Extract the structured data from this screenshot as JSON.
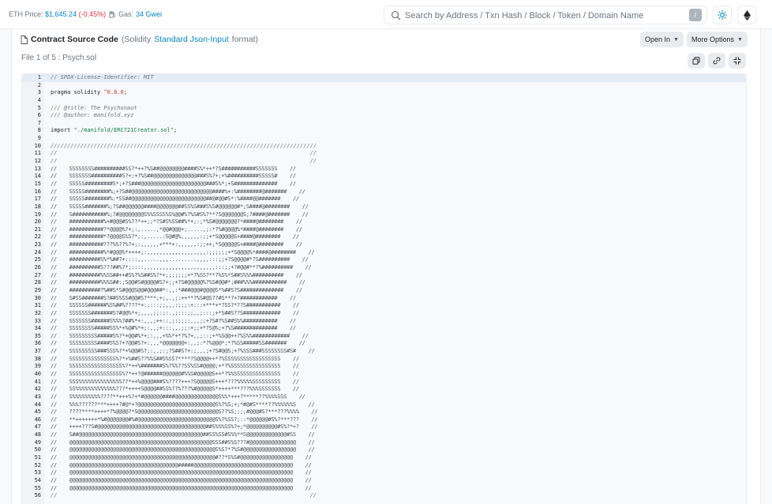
{
  "header": {
    "eth_price_label": "ETH Price:",
    "eth_price_value": "$1,645.24",
    "eth_price_change": "(-0.45%)",
    "gas_label": "Gas:",
    "gas_value": "34 Gwei",
    "search_placeholder": "Search by Address / Txn Hash / Block / Token / Domain Name",
    "search_shortcut": "/"
  },
  "contract": {
    "title": "Contract Source Code",
    "lang_prefix": "(Solidity",
    "lang_link": "Standard Json-Input",
    "lang_suffix": "format)",
    "open_in": "Open In",
    "more_options": "More Options",
    "file_label": "File 1 of 5 : Psych.sol"
  },
  "code_lines": [
    {
      "n": "1",
      "t": "// SPDX-License-Identifier: MIT",
      "k": "cmt"
    },
    {
      "n": "2",
      "t": "",
      "k": ""
    },
    {
      "n": "3",
      "t": "pragma solidity ^0.8.0;",
      "k": "pragma"
    },
    {
      "n": "4",
      "t": "",
      "k": ""
    },
    {
      "n": "5",
      "t": "/// @title: The Psychonaut",
      "k": "cmt"
    },
    {
      "n": "6",
      "t": "/// @author: manifold.xyz",
      "k": "cmt"
    },
    {
      "n": "7",
      "t": "",
      "k": ""
    },
    {
      "n": "8",
      "t": "import \"./manifold/ERC721Creator.sol\";",
      "k": "import"
    },
    {
      "n": "9",
      "t": "",
      "k": ""
    },
    {
      "n": "10",
      "t": "////////////////////////////////////////////////////////////////////////////////",
      "k": "cmt"
    },
    {
      "n": "11",
      "t": "//                                                                            //",
      "k": "cmt"
    },
    {
      "n": "12",
      "t": "//                                                                            //",
      "k": "cmt"
    },
    {
      "n": "13",
      "t": "//    SSSSSSSS##########SS?*++?%S##@@@@@@@@####S%*++*?S###########SSSSSSS    //",
      "k": "art"
    },
    {
      "n": "14",
      "t": "//    SSSSSSS##########S?+;+?%S##@@@@@@@@@@@@@@###S%?+;+%##########SSSSS#    //",
      "k": "art"
    },
    {
      "n": "15",
      "t": "//    SSSSS#########S*;+?S###@@@@@@@@@@@@@@@@@@@@@###S%*;+S##############    //",
      "k": "art"
    },
    {
      "n": "16",
      "t": "//    SSSSS########%;+?S##@@@@@@@@@@@@@@@@@@@@@@@@@@####%+:%########@#######    //",
      "k": "art"
    },
    {
      "n": "17",
      "t": "//    SSSSS########%:*SS##@@@@@@@@@@@@@@@@@@@@@@@@##@#@@#S*:%####@@#######    //",
      "k": "art"
    },
    {
      "n": "18",
      "t": "//    SSSSS#######%;?S##@@@@@@####@@@@@@@##SS%S###S%S#@@@@@@#*;S####@########    //",
      "k": "art"
    },
    {
      "n": "19",
      "t": "//    S###########%;?#@@@@@@@@S%%SSSS%S%@@#%?%S#S%?**?S@@@@@@@S;?####@#######    //",
      "k": "art"
    },
    {
      "n": "20",
      "t": "//    ###########%+#@@@#S%??*++;;*?S#S%SS##%*+;:;*%S#@@@@@@@?*####@########    //",
      "k": "art"
    },
    {
      "n": "21",
      "t": "//    ###########?*@@@@%?+;:,.....,*@@#@@@+;.....,;:*?%#@@@@%*####@########    //",
      "k": "art"
    },
    {
      "n": "22",
      "t": "//    ###########*?@@@@S%S?*;:,.....:S@#@%,,,,,,:;;+*S@@@@@S+####@########    //",
      "k": "art"
    },
    {
      "n": "23",
      "t": "//    ###########???%%??%?+;:,,,,,,+***+:,,,,,,:;;++;*S@@@@@S+####@########    //",
      "k": "art"
    },
    {
      "n": "24",
      "t": "//    ###########%*#@@@%*++++;:,,,,,,,,,,,,,,,,,,,:;;;;;;+*S@@@@%*####@########    //",
      "k": "art"
    },
    {
      "n": "25",
      "t": "//    ##########S%*%##?+::::,,.....,,,.........,,,,:::;;+?S@@@@#*?S##########    //",
      "k": "art"
    },
    {
      "n": "26",
      "t": "//    ##########S???##%?*;::::,,,,,,,,,,,,,,,,,,,,,,,:::;;+?#@@#**?%##########    //",
      "k": "art"
    },
    {
      "n": "27",
      "t": "//    ##########%%SS##++#S%?%S##S%?*+;;;;;;;+*?%SS?**?%S%*S##S%%%##########    //",
      "k": "art"
    },
    {
      "n": "28",
      "t": "//    ##########%%%S##:;S@@#S#@@@@#S?+;;+?S#@@@@@%?%S#@@#*;###%%%###########    //",
      "k": "art"
    },
    {
      "n": "29",
      "t": "//    ##########?%##S*S#@@@S@@#@@@##*:,,:*###@@@#@@@@S*%##S?S##############    //",
      "k": "art"
    },
    {
      "n": "30",
      "t": "//    S#SS#######S?##S%SS#@@#S?***;+;,.,;:++**?%S#@S??#S**?+?############    //",
      "k": "art"
    },
    {
      "n": "31",
      "t": "//    SSSSSS######%S%##%????*+:;:::;;,,,:;;;:+:::+***+*?SS?*??S###########    //",
      "k": "art"
    },
    {
      "n": "32",
      "t": "//    SSSSSSS#######S?#@@%*+;,,,,;;:;:.,;:::;;,,;:::;+*S##S??S############    //",
      "k": "art"
    },
    {
      "n": "33",
      "t": "//    SSSSSSS######S%%%?##%*+:,,,;++::,;:;;;:,,,;;+?S#?%S##S%%###########    //",
      "k": "art"
    },
    {
      "n": "34",
      "t": "//    SSSSSSSS#####SS%*+%@#%*+;:,,;+:::,,,;;:+;;+*?S@%;+?%S##############    //",
      "k": "art"
    },
    {
      "n": "35",
      "t": "//    SSSSSSSSS#####S%?*+@@#%*+;:,,,+%%*+*?%?+,,;::;+*%S@@++?%S%%############    //",
      "k": "art"
    },
    {
      "n": "36",
      "t": "//    SSSSSSSSS####S%S?+?@@#S?+:,,,*@@@@@@@+:,,;:*?%@@@*;*?%SS#####SS#######    //",
      "k": "art"
    },
    {
      "n": "37",
      "t": "//    SSSSSSSSS###SSS%?*+%@@#S?;:,,;:;?S##S?+:;,,,;+?S#@@S;+?%SSS###SSSSSSSS#S#    //",
      "k": "art"
    },
    {
      "n": "38",
      "t": "//    SSSSSSSSSSSSSSS%?*+%##S??%%S##S%SS?****?S@@@@++*?%SSSSSSSSSSSSSSSSSS    //",
      "k": "art"
    },
    {
      "n": "39",
      "t": "//    SSSSSSSSSSSSSSSSS%?*++%#######S%?%%??SS%SS#@@@@;+*?%SSSSSSSSSSSSSSSS    //",
      "k": "art"
    },
    {
      "n": "40",
      "t": "//    SSSSSSSSSSSSSSSSS%?*++?@######@@@@@@#%%S#@@@@@S++*?%%SSSSSSSSSSSSSSS    //",
      "k": "art"
    },
    {
      "n": "41",
      "t": "//    SSS%%%%%%%%%%%%%%??*++%@@@@###S%????+++?S@@@@@S+++*???%%%%%SSSSSSSSS    //",
      "k": "art"
    },
    {
      "n": "42",
      "t": "//    SS%%%%%%%%%%%%%???*++++S@@@@##SS%??%???%#@@@@@S*++++***???%%%SSSSSSS    //",
      "k": "art"
    },
    {
      "n": "43",
      "t": "//    S%%%%%%%%%????**+++%?+*#@@@@@@####@@@@@@@@@@@@@@S%%*+++?*****??%%%%SSS    //",
      "k": "art"
    },
    {
      "n": "44",
      "t": "//    %%%??????***++++?#@*+?@@@@@@@@@@@@@@@@@@@@@@@@@S%?%S;+;*#@#S****??%%%%%%S    //",
      "k": "art"
    },
    {
      "n": "45",
      "t": "//    ????****++++*?%@@@@?*S@@@@@@@@@@@@@@@@@@@@@@@@@@S??%S;;;;#@@@#S?***???%%%%    //",
      "k": "art"
    },
    {
      "n": "46",
      "t": "//    **+++++++*%#@@@@@@@#%#@@@@@@@@@@@@@@@@@@@@@@@@@S%?%SS?;::*@@@@@@#S%?***???    //",
      "k": "art"
    },
    {
      "n": "47",
      "t": "//    ++++???S#@@@@@@@@@@@@@@@@@@@@@@@@@@@@@@@@@@@##S%%%SS%?+;*@@@@@@@@@@#S%?*+?    //",
      "k": "art"
    },
    {
      "n": "48",
      "t": "//    S##@@@@@@@@@@@@@@@@@@@@@@@@@@@@@@@@@@@@@@@@##SS%SS#S%%**S@@@@@@@@@@@@@#SS    //",
      "k": "art"
    },
    {
      "n": "49",
      "t": "//    @@@@@@@@@@@@@@@@@@@@@@@@@@@@@@@@@@@@@@@@@@@@@@SSS##S%S???#@@@@@@@@@@@@@@@    //",
      "k": "art"
    },
    {
      "n": "50",
      "t": "//    @@@@@@@@@@@@@@@@@@@@@@@@@@@@@@@@@@@@@@@@@@@@@@@S%S?*?%S#@@@@@@@@@@@@@@@@@    //",
      "k": "art"
    },
    {
      "n": "51",
      "t": "//    @@@@@@@@@@@@@@@@@@@@@@@@@@@@@@@@@@@@@@@@@@@@@@@#??*S%S#@@@@@@@@@@@@@@@@@    //",
      "k": "art"
    },
    {
      "n": "52",
      "t": "//    @@@@@@@@@@@@@@@@@@@@@@@@@@@@@@@@@@@#####@@@@@@@@@@@@@@@@@@@@@@@@@@@@@@@@    //",
      "k": "art"
    },
    {
      "n": "53",
      "t": "//    @@@@@@@@@@@@@@@@@@@@@@@@@@@@@@@@@@@@@@@@@@@@@@@@@@@@@@@@@@@@@@@@@@@@@@@@    //",
      "k": "art"
    },
    {
      "n": "54",
      "t": "//    @@@@@@@@@@@@@@@@@@@@@@@@@@@@@@@@@@@@@@@@@@@@@@@@@@@@@@@@@@@@@@@@@@@@@@@@    //",
      "k": "art"
    },
    {
      "n": "55",
      "t": "//    @@@@@@@@@@@@@@@@@@@@@@@@@@@@@@@@@@@@@@@@@@@@@@@@@@@@@@@@@@@@@@@@@@@@@@@@    //",
      "k": "art"
    },
    {
      "n": "56",
      "t": "//                                                                            //",
      "k": "cmt"
    }
  ],
  "colors": {
    "accent": "#0784c3",
    "negative": "#dc3545",
    "active_line": "#e4ecf6"
  },
  "icons": {
    "gas": "gas-pump-icon",
    "search": "search-icon",
    "theme": "sun-icon",
    "network": "ethereum-icon",
    "file": "file-icon",
    "copy": "copy-icon",
    "link": "link-icon",
    "fullscreen": "expand-icon"
  }
}
